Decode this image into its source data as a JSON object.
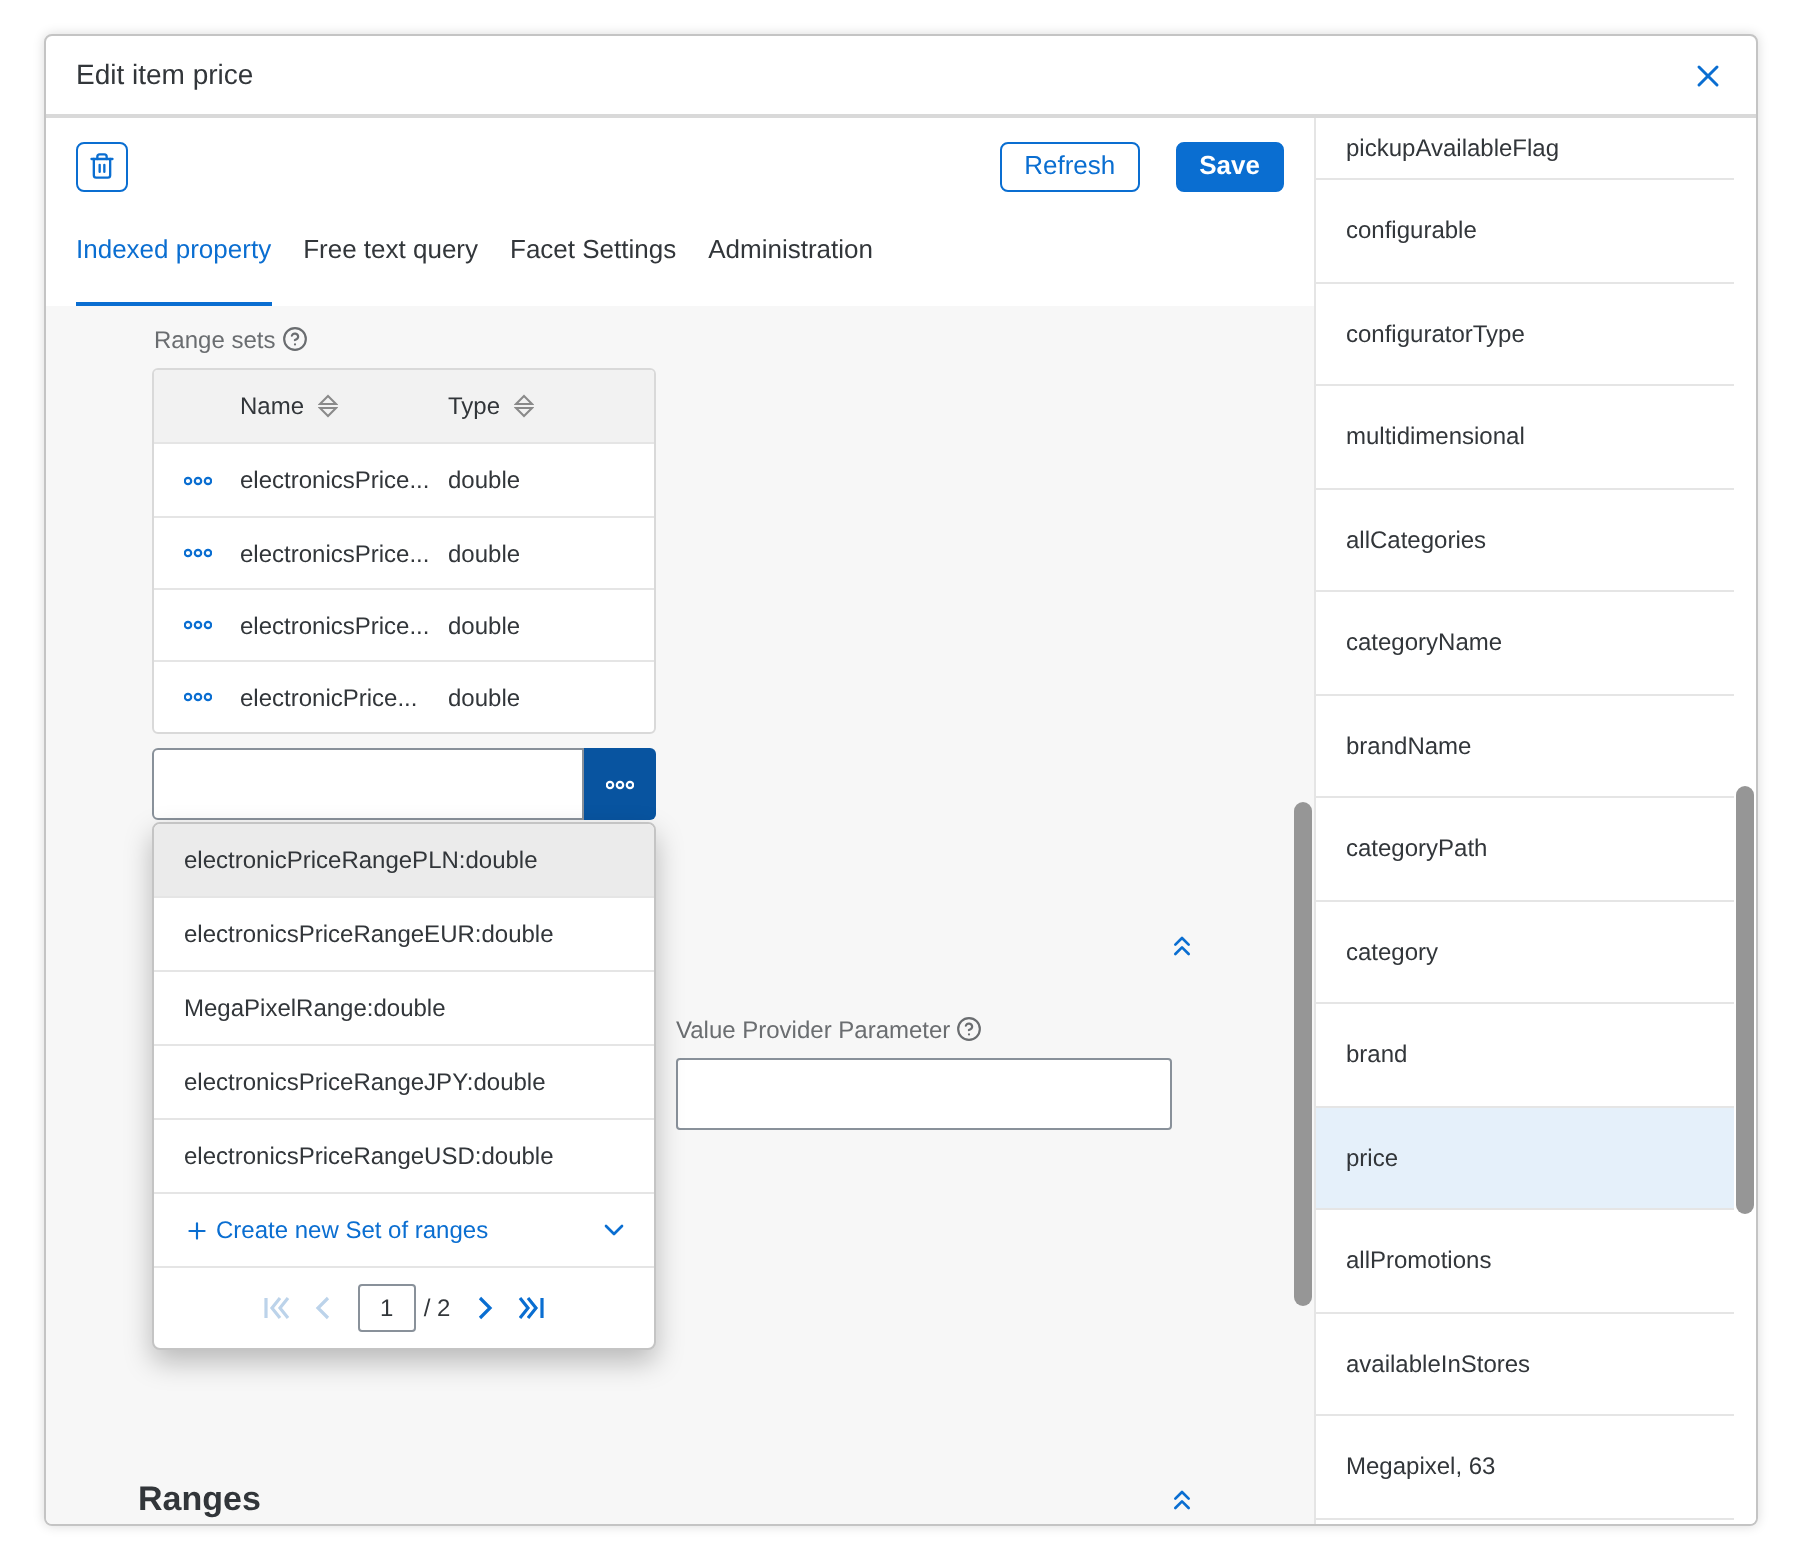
{
  "dialog": {
    "title": "Edit item price"
  },
  "toolbar": {
    "buttons": [
      {
        "label": "Refresh",
        "kind": "secondary"
      },
      {
        "label": "Save",
        "kind": "primary"
      }
    ]
  },
  "tabs": [
    {
      "label": "Indexed property",
      "selected": true
    },
    {
      "label": "Free text query",
      "selected": false
    },
    {
      "label": "Facet Settings",
      "selected": false
    },
    {
      "label": "Administration",
      "selected": false
    }
  ],
  "range_sets": {
    "label": "Range sets",
    "columns": [
      "Name",
      "Type"
    ],
    "rows": [
      {
        "name": "electronicsPrice...",
        "type": "double"
      },
      {
        "name": "electronicsPrice...",
        "type": "double"
      },
      {
        "name": "electronicsPrice...",
        "type": "double"
      },
      {
        "name": "electronicPrice...",
        "type": "double"
      }
    ]
  },
  "dropdown": {
    "options": [
      {
        "label": "electronicPriceRangePLN:double",
        "selected": true
      },
      {
        "label": "electronicsPriceRangeEUR:double",
        "selected": false
      },
      {
        "label": "MegaPixelRange:double",
        "selected": false
      },
      {
        "label": "electronicsPriceRangeJPY:double",
        "selected": false
      },
      {
        "label": "electronicsPriceRangeUSD:double",
        "selected": false
      }
    ],
    "create_link": "Create new Set of ranges",
    "pagination": {
      "page": "1",
      "total": "/ 2",
      "nav": [
        {
          "kind": "first",
          "disabled": true
        },
        {
          "kind": "prev",
          "disabled": true
        },
        {
          "kind": "next",
          "disabled": false
        },
        {
          "kind": "last",
          "disabled": false
        }
      ]
    }
  },
  "sections": [
    {
      "title": "Ranges"
    }
  ],
  "value_provider_parameter": {
    "label": "Value Provider Parameter"
  },
  "property_list": [
    {
      "label": "pickupAvailableFlag",
      "selected": false
    },
    {
      "label": "configurable",
      "selected": false
    },
    {
      "label": "configuratorType",
      "selected": false
    },
    {
      "label": "multidimensional",
      "selected": false
    },
    {
      "label": "allCategories",
      "selected": false
    },
    {
      "label": "categoryName",
      "selected": false
    },
    {
      "label": "brandName",
      "selected": false
    },
    {
      "label": "categoryPath",
      "selected": false
    },
    {
      "label": "category",
      "selected": false
    },
    {
      "label": "brand",
      "selected": false
    },
    {
      "label": "price",
      "selected": true
    },
    {
      "label": "allPromotions",
      "selected": false
    },
    {
      "label": "availableInStores",
      "selected": false
    },
    {
      "label": "Megapixel, 63",
      "selected": false
    }
  ]
}
